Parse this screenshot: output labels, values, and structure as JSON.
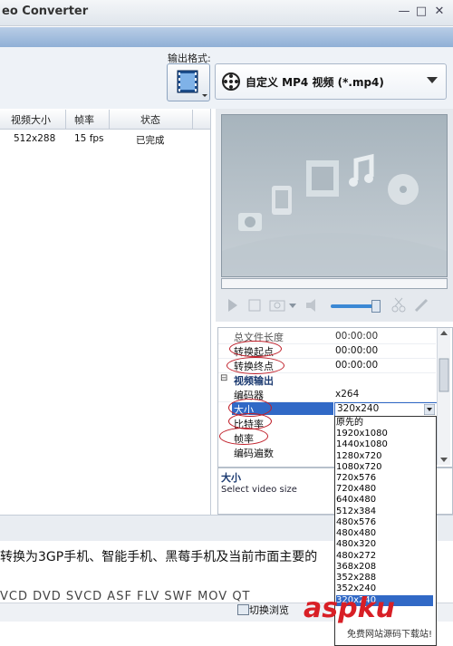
{
  "window": {
    "title": "eo Converter",
    "min_symbol": "—",
    "max_symbol": "□",
    "close_symbol": "✕"
  },
  "format": {
    "label": "输出格式:",
    "selected": "自定义 MP4 视频 (*.mp4)",
    "icon": "film-icon"
  },
  "file_list": {
    "columns": [
      "视频大小",
      "帧率",
      "状态"
    ],
    "rows": [
      {
        "size": "512x288",
        "fps": "15 fps",
        "status": "已完成"
      }
    ]
  },
  "preview": {
    "icons": [
      "film-icon",
      "music-note-icon",
      "phone-icon",
      "cd-icon",
      "camera-icon"
    ],
    "volume_level": 0.85
  },
  "properties": {
    "rows": [
      {
        "name": "总文件长度",
        "value": "00:00:00"
      },
      {
        "name": "转换起点",
        "value": "00:00:00"
      },
      {
        "name": "转换终点",
        "value": "00:00:00"
      }
    ],
    "group": "视频输出",
    "video_rows": [
      {
        "name": "编码器",
        "value": "x264"
      },
      {
        "name": "大小",
        "value": "320x240"
      },
      {
        "name": "比特率",
        "value": ""
      },
      {
        "name": "帧率",
        "value": ""
      },
      {
        "name": "编码遍数",
        "value": ""
      }
    ],
    "group_toggle": "⊟"
  },
  "description": {
    "title": "大小",
    "text": "Select video size"
  },
  "size_dropdown": {
    "options": [
      "原先的",
      "1920x1080",
      "1440x1080",
      "1280x720",
      "1080x720",
      "720x576",
      "720x480",
      "640x480",
      "512x384",
      "480x576",
      "480x480",
      "480x320",
      "480x272",
      "368x208",
      "352x288",
      "352x240",
      "320x240"
    ],
    "selected": "320x240"
  },
  "bottom": {
    "description_line": "转换为3GP手机、智能手机、黑莓手机及当前市面主要的",
    "formats_line": "VCD  DVD  SVCD  ASF  FLV  SWF  MOV  QT",
    "switch_button": "切换浏览"
  },
  "watermark": {
    "brand": "aspku",
    "subtitle": "免费网站源码下载站!"
  }
}
